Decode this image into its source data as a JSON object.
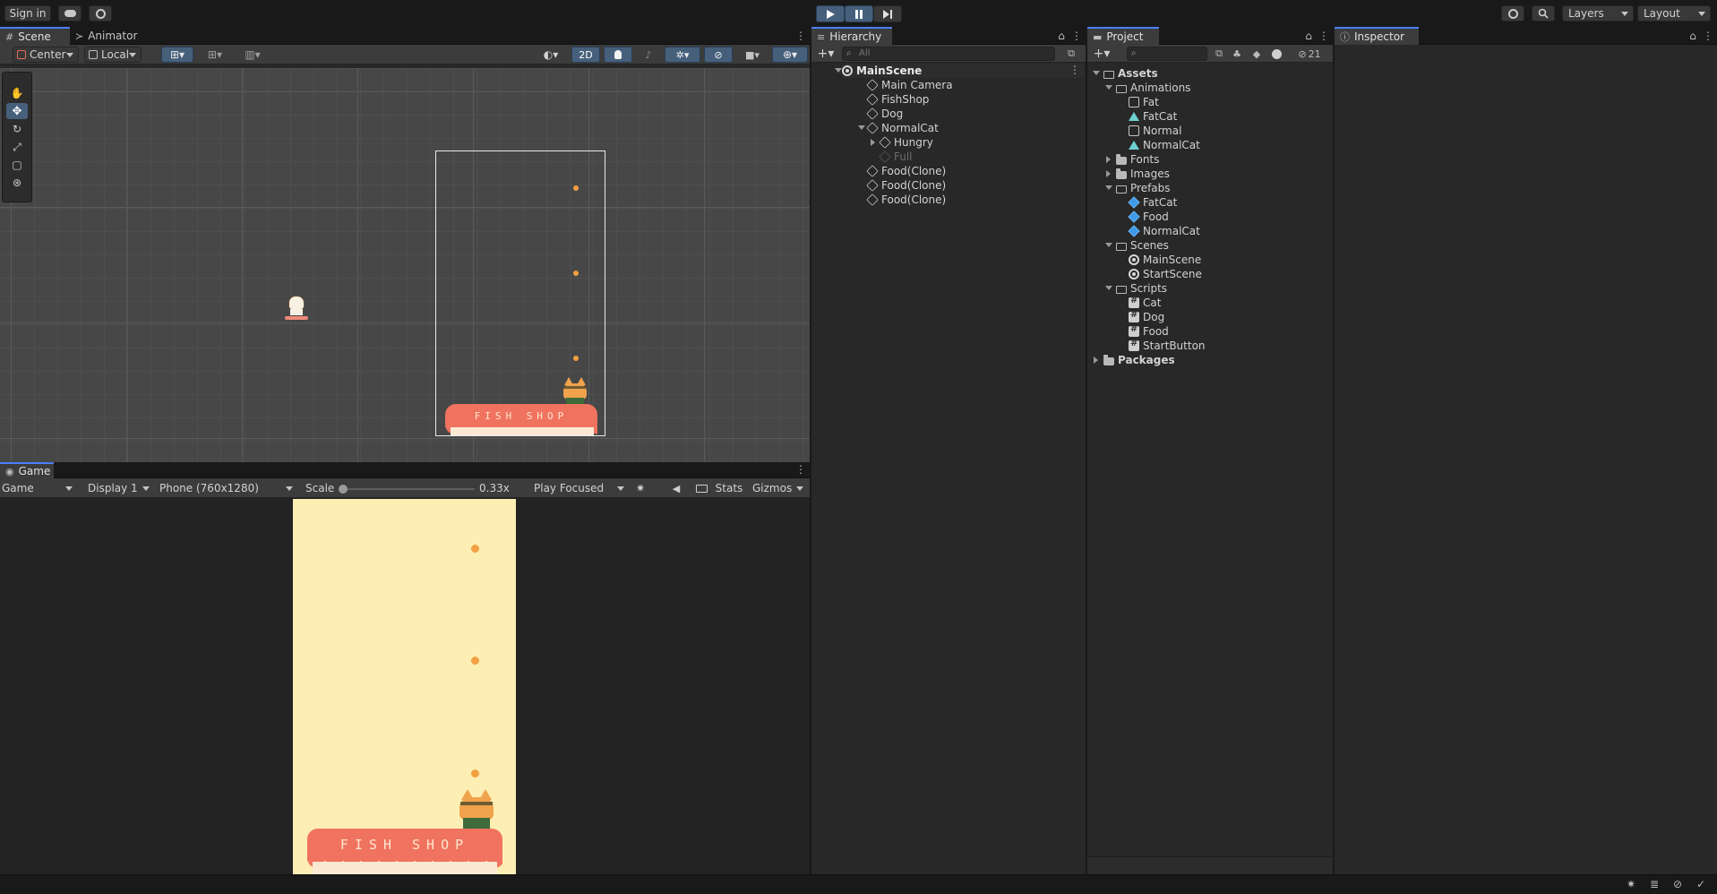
{
  "topbar": {
    "sign_in_label": "Sign in",
    "layers_label": "Layers",
    "layout_label": "Layout"
  },
  "scene": {
    "tab_scene": "Scene",
    "tab_animator": "Animator",
    "pivot_label": "Center",
    "space_label": "Local",
    "mode_2d_label": "2D"
  },
  "game": {
    "tab_label": "Game",
    "game_dropdown": "Game",
    "display_dropdown": "Display 1",
    "resolution_dropdown": "Phone (760x1280)",
    "scale_label": "Scale",
    "scale_value": "0.33x",
    "play_focused": "Play Focused",
    "stats_label": "Stats",
    "gizmos_label": "Gizmos",
    "background_color": "#fdeeb4",
    "shop_sign_text": "FISH SHOP",
    "scene_shop_sign_text": "FISH SHOP"
  },
  "hierarchy": {
    "tab_label": "Hierarchy",
    "search_placeholder": "All",
    "items": [
      {
        "label": "MainScene"
      },
      {
        "label": "Main Camera"
      },
      {
        "label": "FishShop"
      },
      {
        "label": "Dog"
      },
      {
        "label": "NormalCat"
      },
      {
        "label": "Hungry"
      },
      {
        "label": "Full"
      },
      {
        "label": "Food(Clone)"
      },
      {
        "label": "Food(Clone)"
      },
      {
        "label": "Food(Clone)"
      }
    ]
  },
  "project": {
    "tab_label": "Project",
    "hidden_count": "21",
    "items": [
      {
        "label": "Assets",
        "icon": "folder-open-icon"
      },
      {
        "label": "Animations",
        "icon": "folder-open-icon"
      },
      {
        "label": "Fat",
        "icon": "animator-controller-icon"
      },
      {
        "label": "FatCat",
        "icon": "animation-clip-icon"
      },
      {
        "label": "Normal",
        "icon": "animator-controller-icon"
      },
      {
        "label": "NormalCat",
        "icon": "animation-clip-icon"
      },
      {
        "label": "Fonts",
        "icon": "folder-icon"
      },
      {
        "label": "Images",
        "icon": "folder-icon"
      },
      {
        "label": "Prefabs",
        "icon": "folder-open-icon"
      },
      {
        "label": "FatCat",
        "icon": "prefab-icon"
      },
      {
        "label": "Food",
        "icon": "prefab-icon"
      },
      {
        "label": "NormalCat",
        "icon": "prefab-icon"
      },
      {
        "label": "Scenes",
        "icon": "folder-open-icon"
      },
      {
        "label": "MainScene",
        "icon": "unity-scene-icon"
      },
      {
        "label": "StartScene",
        "icon": "unity-scene-icon"
      },
      {
        "label": "Scripts",
        "icon": "folder-open-icon"
      },
      {
        "label": "Cat",
        "icon": "script-icon"
      },
      {
        "label": "Dog",
        "icon": "script-icon"
      },
      {
        "label": "Food",
        "icon": "script-icon"
      },
      {
        "label": "StartButton",
        "icon": "script-icon"
      },
      {
        "label": "Packages",
        "icon": "folder-icon"
      }
    ]
  },
  "inspector": {
    "tab_label": "Inspector"
  }
}
